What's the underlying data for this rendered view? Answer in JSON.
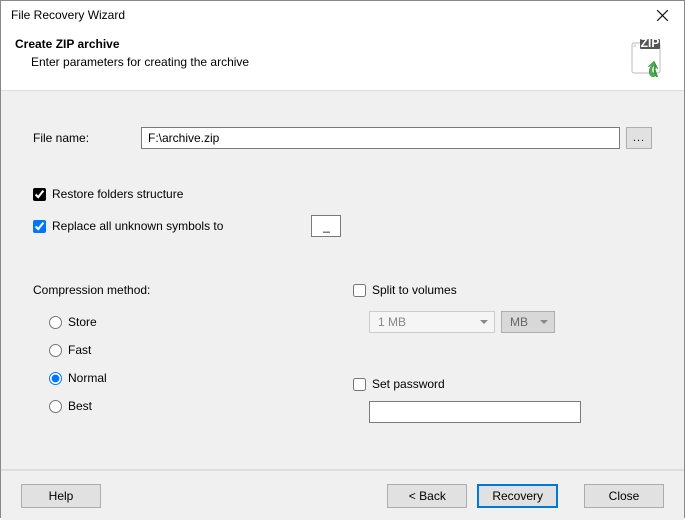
{
  "window": {
    "title": "File Recovery Wizard"
  },
  "header": {
    "title": "Create ZIP archive",
    "subtitle": "Enter parameters for creating the archive"
  },
  "filename": {
    "label": "File name:",
    "value": "F:\\archive.zip",
    "browse": "..."
  },
  "options": {
    "restore_label": "Restore folders structure",
    "restore_checked": true,
    "replace_label": "Replace all unknown symbols to",
    "replace_checked": true,
    "replace_value": "_"
  },
  "compression": {
    "label": "Compression method:",
    "store": "Store",
    "fast": "Fast",
    "normal": "Normal",
    "best": "Best",
    "selected": "normal"
  },
  "split": {
    "label": "Split to volumes",
    "checked": false,
    "size_value": "1 MB",
    "unit_value": "MB"
  },
  "password": {
    "label": "Set password",
    "checked": false,
    "value": ""
  },
  "footer": {
    "help": "Help",
    "back": "< Back",
    "recovery": "Recovery",
    "close": "Close"
  }
}
